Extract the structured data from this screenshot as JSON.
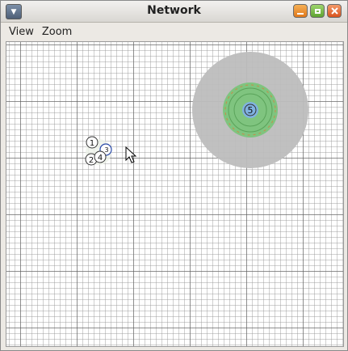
{
  "window": {
    "title": "Network"
  },
  "menu": {
    "items": [
      "View",
      "Zoom"
    ]
  },
  "graph": {
    "nodes": [
      {
        "id": "1",
        "label": "1"
      },
      {
        "id": "2",
        "label": "2"
      },
      {
        "id": "3",
        "label": "3"
      },
      {
        "id": "4",
        "label": "4"
      },
      {
        "id": "5",
        "label": "5"
      }
    ]
  },
  "colors": {
    "range_outer": "#bdbdbd",
    "range_green": "#7fc47f",
    "node_highlight": "#7fb2e0"
  }
}
